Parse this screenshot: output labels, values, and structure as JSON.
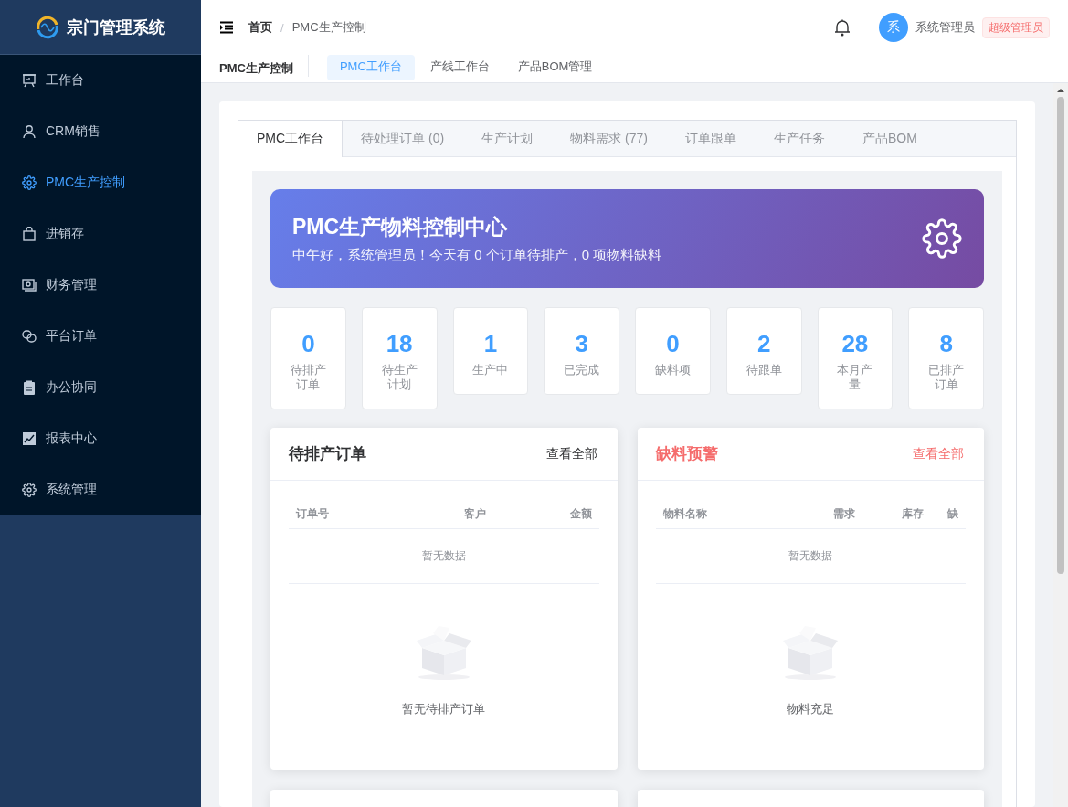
{
  "app": {
    "title": "宗门管理系统"
  },
  "sidebar": {
    "items": [
      {
        "label": "工作台",
        "selected": false
      },
      {
        "label": "CRM销售",
        "selected": false
      },
      {
        "label": "PMC生产控制",
        "selected": true
      },
      {
        "label": "进销存",
        "selected": false
      },
      {
        "label": "财务管理",
        "selected": false
      },
      {
        "label": "平台订单",
        "selected": false
      },
      {
        "label": "办公协同",
        "selected": false
      },
      {
        "label": "报表中心",
        "selected": false
      },
      {
        "label": "系统管理",
        "selected": false
      }
    ]
  },
  "header": {
    "breadcrumb": [
      "首页",
      "PMC生产控制"
    ],
    "breadcrumb_separator": "/",
    "user": {
      "avatar": "系",
      "name": "系统管理员",
      "role": "超级管理员"
    }
  },
  "page_tabs": {
    "title": "PMC生产控制",
    "tabs": [
      {
        "label": "PMC工作台",
        "selected": true
      },
      {
        "label": "产线工作台",
        "selected": false
      },
      {
        "label": "产品BOM管理",
        "selected": false
      }
    ]
  },
  "inner_tabs": [
    {
      "label": "PMC工作台",
      "selected": true
    },
    {
      "label": "待处理订单 (0)",
      "selected": false
    },
    {
      "label": "生产计划",
      "selected": false
    },
    {
      "label": "物料需求 (77)",
      "selected": false
    },
    {
      "label": "订单跟单",
      "selected": false
    },
    {
      "label": "生产任务",
      "selected": false
    },
    {
      "label": "产品BOM",
      "selected": false
    }
  ],
  "banner": {
    "title": "PMC生产物料控制中心",
    "subtitle": "中午好，系统管理员！今天有 0 个订单待排产，0 项物料缺料"
  },
  "stats": [
    {
      "value": "0",
      "label": "待排产订单"
    },
    {
      "value": "18",
      "label": "待生产计划"
    },
    {
      "value": "1",
      "label": "生产中"
    },
    {
      "value": "3",
      "label": "已完成"
    },
    {
      "value": "0",
      "label": "缺料项"
    },
    {
      "value": "2",
      "label": "待跟单"
    },
    {
      "value": "28",
      "label": "本月产量"
    },
    {
      "value": "8",
      "label": "已排产订单"
    }
  ],
  "panels": [
    {
      "kind": "normal",
      "title": "待排产订单",
      "link": "查看全部",
      "columns": [
        "订单号",
        "客户",
        "金额"
      ],
      "table_empty": "暂无数据",
      "empty_text": "暂无待排产订单"
    },
    {
      "kind": "warning",
      "title": "缺料预警",
      "link": "查看全部",
      "columns": [
        "物料名称",
        "需求",
        "库存",
        "缺"
      ],
      "table_empty": "暂无数据",
      "empty_text": "物料充足"
    }
  ]
}
